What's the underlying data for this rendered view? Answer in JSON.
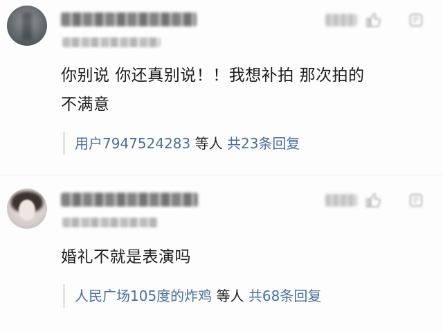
{
  "comments": [
    {
      "text_line1": "你别说 你还真别说！！我想补拍 那次拍的",
      "text_line2": "不满意",
      "reply": {
        "users": "用户7947524283",
        "separator": " 等人 ",
        "count": "共23条回复"
      }
    },
    {
      "text_line1": "婚礼不就是表演吗",
      "reply": {
        "users": "人民广场105度的炸鸡",
        "separator": " 等人 ",
        "count": "共68条回复"
      }
    }
  ],
  "icons": {
    "like": "thumbs-up-icon",
    "dislike": "thumbs-down-icon"
  },
  "colors": {
    "link": "#4a6f9a",
    "text": "#1c1c1c"
  }
}
